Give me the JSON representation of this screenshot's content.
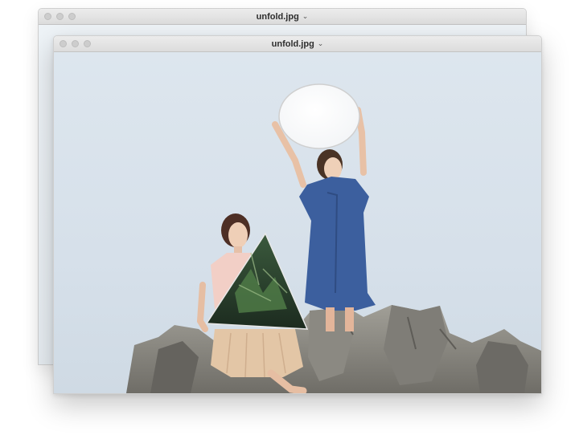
{
  "windows": [
    {
      "title": "unfold.jpg",
      "chevron_icon": "chevron-down-icon",
      "state": "background"
    },
    {
      "title": "unfold.jpg",
      "chevron_icon": "chevron-down-icon",
      "state": "active"
    }
  ],
  "photo": {
    "sky_color": "#d9e3ec",
    "rock_color": "#8d8b84",
    "dress_color": "#3c5f9e",
    "skirt_color": "#e3c6a6",
    "top_color": "#f2cfc6"
  }
}
